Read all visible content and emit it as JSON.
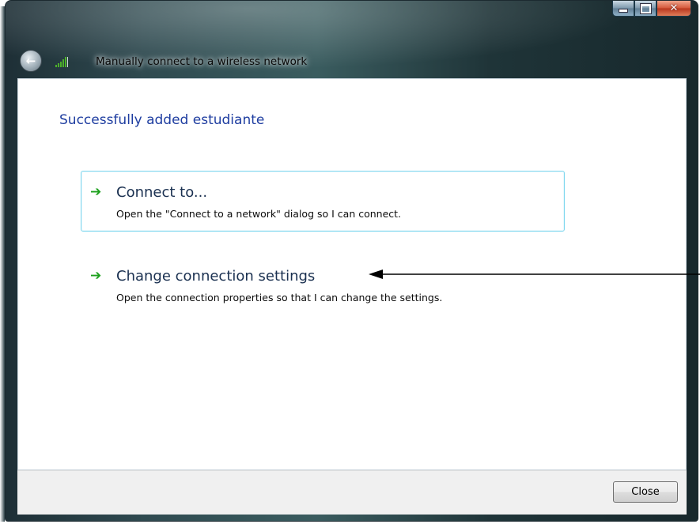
{
  "window": {
    "title": "Manually connect to a wireless network",
    "caption_minimize": "minimize-icon",
    "caption_maximize": "maximize-icon",
    "caption_close": "close-icon"
  },
  "content": {
    "heading": "Successfully added estudiante",
    "options": [
      {
        "title": "Connect to...",
        "description": "Open the \"Connect to a network\" dialog so I can connect."
      },
      {
        "title": "Change connection settings",
        "description": "Open the connection properties so that I can change the settings."
      }
    ]
  },
  "footer": {
    "close_label": "Close"
  },
  "colors": {
    "heading": "#1e3da0",
    "arrow": "#1ea11e",
    "hover_border": "#7ed7ee"
  }
}
